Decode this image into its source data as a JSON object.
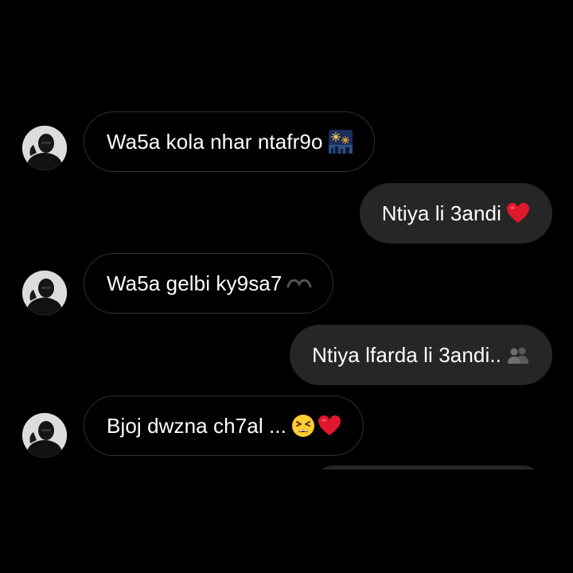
{
  "messages": [
    {
      "direction": "incoming",
      "text": "Wa5a kola nhar ntafr9o",
      "emoji": "fireworks-icon"
    },
    {
      "direction": "outgoing",
      "text": "Ntiya li 3andi",
      "emoji": "red-heart-icon"
    },
    {
      "direction": "incoming",
      "text": "Wa5a gelbi ky9sa7",
      "emoji": "broken-heart-icon"
    },
    {
      "direction": "outgoing",
      "text": "Ntiya lfarda li 3andi..",
      "emoji": "busts-icon"
    },
    {
      "direction": "incoming",
      "text": "Bjoj dwzna ch7al ...",
      "emoji": "tired-face-and-red-heart-icons"
    }
  ],
  "colors": {
    "background": "#000000",
    "outgoing_bubble": "#262626",
    "incoming_border": "#2f2f2f",
    "text": "#ffffff",
    "heart": "#e0182d"
  }
}
